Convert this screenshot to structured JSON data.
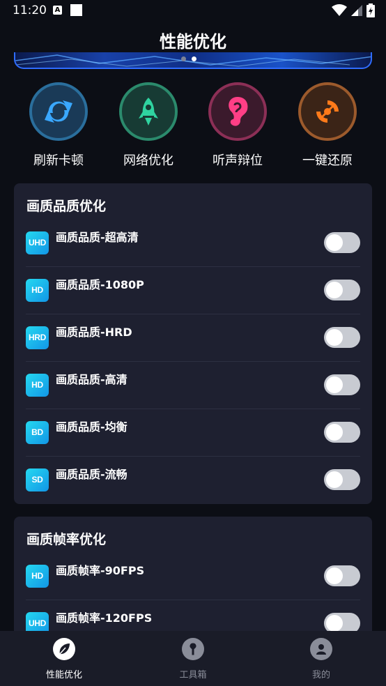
{
  "status_bar": {
    "time": "11:20",
    "a_icon": "A"
  },
  "header": {
    "title": "性能优化"
  },
  "quick_actions": [
    {
      "label": "刷新卡顿",
      "icon": "refresh-icon",
      "color": "#3aa8ff"
    },
    {
      "label": "网络优化",
      "icon": "rocket-icon",
      "color": "#2fd3a0"
    },
    {
      "label": "听声辩位",
      "icon": "ear-icon",
      "color": "#ff3f86"
    },
    {
      "label": "一键还原",
      "icon": "restore-icon",
      "color": "#ff7a1a"
    }
  ],
  "quality_card": {
    "title": "画质品质优化",
    "items": [
      {
        "badge": "UHD",
        "label": "画质品质-超高清",
        "enabled": false
      },
      {
        "badge": "HD",
        "label": "画质品质-1080P",
        "enabled": false
      },
      {
        "badge": "HRD",
        "label": "画质品质-HRD",
        "enabled": false
      },
      {
        "badge": "HD",
        "label": "画质品质-高清",
        "enabled": false
      },
      {
        "badge": "BD",
        "label": "画质品质-均衡",
        "enabled": false
      },
      {
        "badge": "SD",
        "label": "画质品质-流畅",
        "enabled": false
      }
    ]
  },
  "framerate_card": {
    "title": "画质帧率优化",
    "items": [
      {
        "badge": "HD",
        "label": "画质帧率-90FPS",
        "enabled": false
      },
      {
        "badge": "UHD",
        "label": "画质帧率-120FPS",
        "enabled": false
      }
    ]
  },
  "bottom_nav": [
    {
      "label": "性能优化",
      "icon": "leaf-icon",
      "active": true
    },
    {
      "label": "工具箱",
      "icon": "wrench-icon",
      "active": false
    },
    {
      "label": "我的",
      "icon": "user-icon",
      "active": false
    }
  ],
  "colors": {
    "active_nav": "#ffffff",
    "inactive_nav": "#8a8d99",
    "card_bg": "#1e2030"
  }
}
